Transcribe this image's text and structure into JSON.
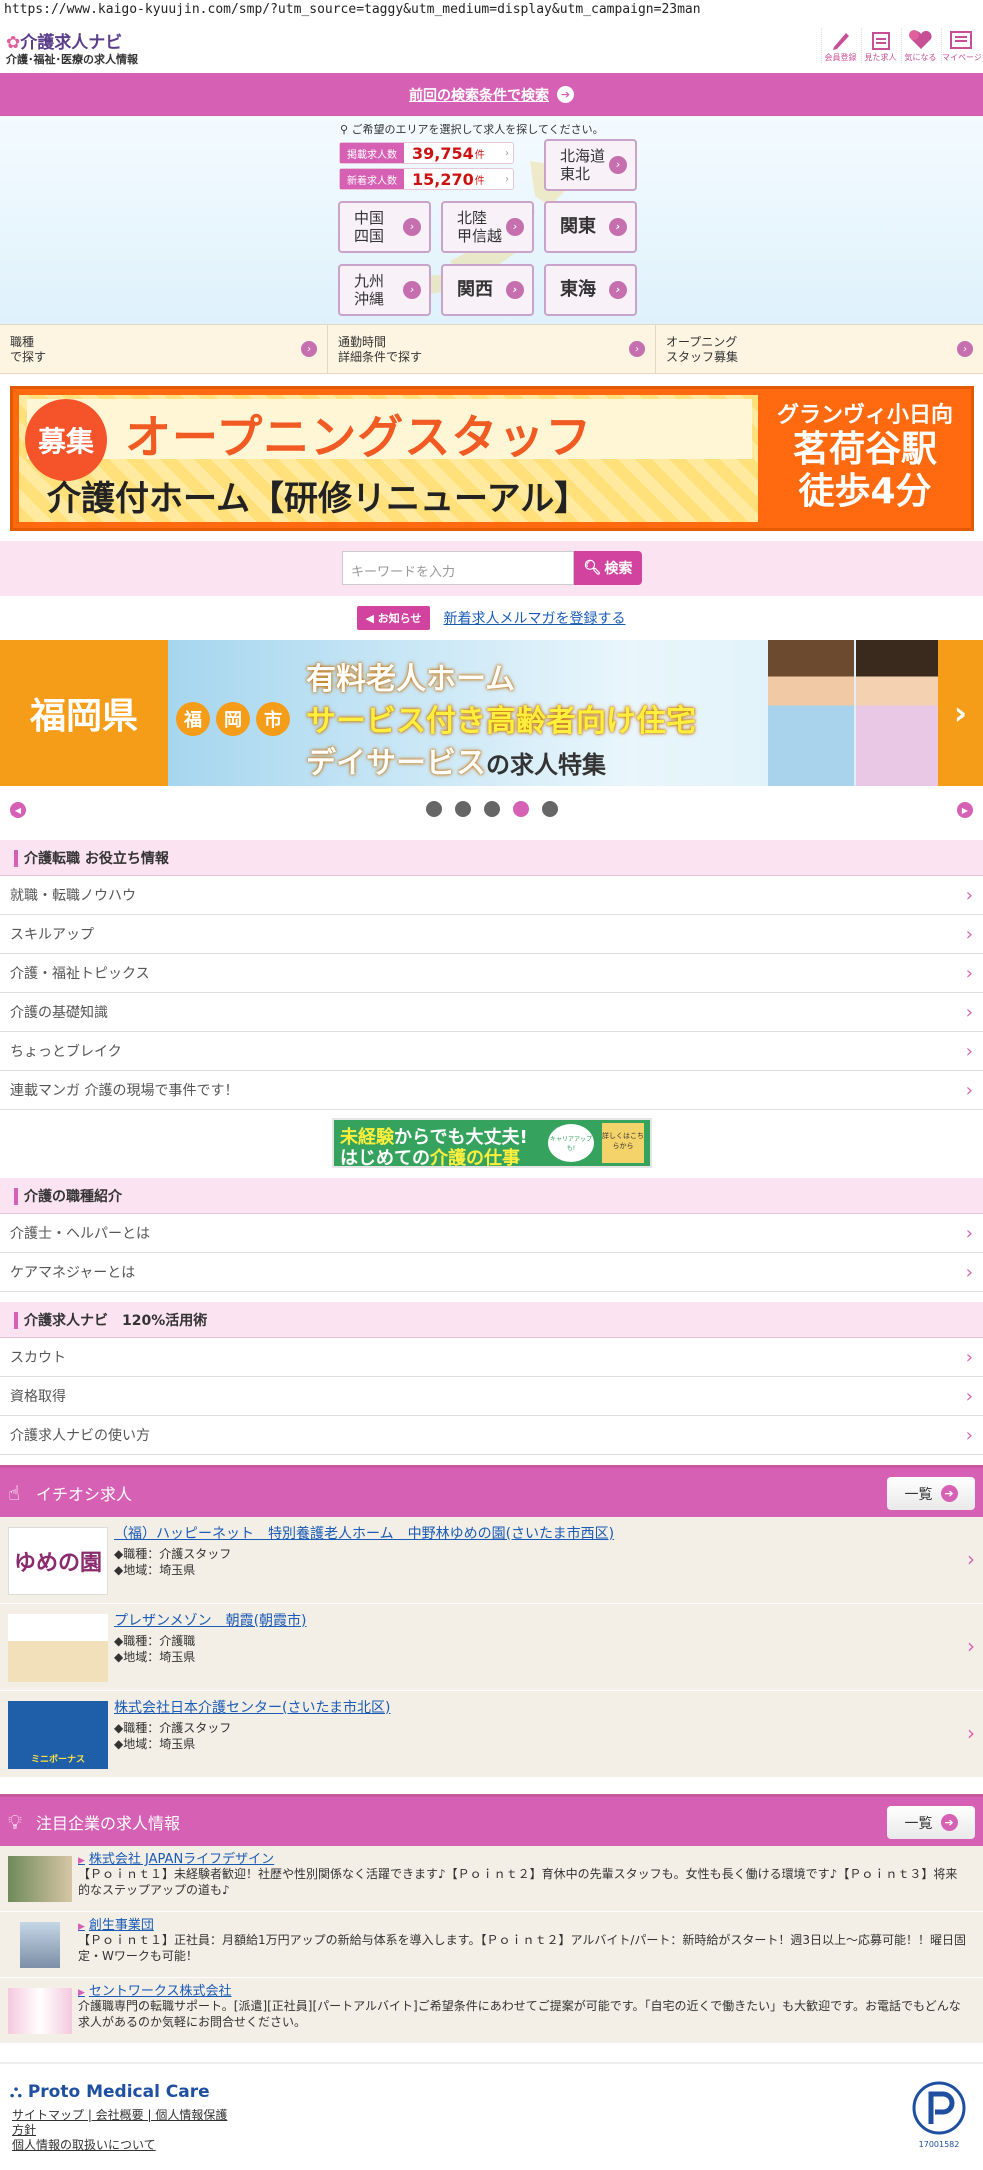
{
  "url": "https://www.kaigo-kyuujin.com/smp/?utm_source=taggy&utm_medium=display&utm_campaign=23man",
  "header": {
    "logo_title": "介護求人ナビ",
    "logo_sub": "介護･福祉･医療の求人情報",
    "icons": [
      {
        "name": "pencil-icon",
        "label": "会員登録"
      },
      {
        "name": "calendar-icon",
        "label": "見た求人"
      },
      {
        "name": "heart-icon",
        "label": "気になる"
      },
      {
        "name": "mypage-icon",
        "label": "マイページ"
      }
    ]
  },
  "prev_search": "前回の検索条件で検索",
  "area": {
    "note": "ご希望のエリアを選択して求人を探してください。",
    "count1_label": "掲載求人数",
    "count1": "39,754",
    "count2_label": "新着求人数",
    "count2": "15,270",
    "unit": "件",
    "regions": [
      "北海道\n東北",
      "中国\n四国",
      "北陸\n甲信越",
      "関東",
      "九州\n沖縄",
      "関西",
      "東海"
    ]
  },
  "search_bar": {
    "c1": "職種\nで探す",
    "c2": "通勤時間\n詳細条件で探す",
    "c3": "オープニング\nスタッフ募集"
  },
  "banner1": {
    "boshu": "募集",
    "headline": "オープニングスタッフ",
    "sub": "介護付ホーム【研修リニューアル】",
    "place": "グランヴィ小日向",
    "station": "茗荷谷駅",
    "walk": "徒歩4分"
  },
  "keyword": {
    "placeholder": "キーワードを入力",
    "button": "検索"
  },
  "notice": {
    "tag": "お知らせ",
    "link": "新着求人メルマガを登録する"
  },
  "carousel": {
    "pref": "福岡県",
    "city": [
      "福",
      "岡",
      "市"
    ],
    "line1": "有料老人ホーム",
    "line2": "サービス付き高齢者向け住宅",
    "line3": "デイサービス",
    "line3b": "の求人特集",
    "dots": 5,
    "active": 4
  },
  "sec1": {
    "title": "介護転職 お役立ち情報",
    "items": [
      "就職・転職ノウハウ",
      "スキルアップ",
      "介護・福祉トピックス",
      "介護の基礎知識",
      "ちょっとブレイク",
      "連載マンガ 介護の現場で事件です！"
    ]
  },
  "banner2": {
    "a1": "未経験",
    "a2": "からでも大丈夫!",
    "b1": "はじめての",
    "b2": "介護の仕事",
    "circle": "キャリアアップも!",
    "box": "詳しくはこちらから"
  },
  "sec2": {
    "title": "介護の職種紹介",
    "items": [
      "介護士・ヘルパーとは",
      "ケアマネジャーとは"
    ]
  },
  "sec3": {
    "title": "介護求人ナビ　120%活用術",
    "items": [
      "スカウト",
      "資格取得",
      "介護求人ナビの使い方"
    ]
  },
  "pickup": {
    "title": "イチオシ求人",
    "more": "一覧",
    "items": [
      {
        "title": "（福）ハッピーネット　特別養護老人ホーム　中野林ゆめの園(さいたま市西区)",
        "job": "◆職種：介護スタッフ",
        "area": "◆地域：埼玉県",
        "img_text": "ゆめの園"
      },
      {
        "title": "プレザンメゾン　朝霞(朝霞市)",
        "job": "◆職種：介護職",
        "area": "◆地域：埼玉県",
        "img_text": ""
      },
      {
        "title": "株式会社日本介護センター(さいたま市北区)",
        "job": "◆職種：介護スタッフ",
        "area": "◆地域：埼玉県",
        "img_text": "ミニボーナス"
      }
    ]
  },
  "company": {
    "title": "注目企業の求人情報",
    "more": "一覧",
    "items": [
      {
        "name": "株式会社 JAPANライフデザイン",
        "desc": "【Ｐｏｉｎｔ１】未経験者歓迎！社歴や性別関係なく活躍できます♪【Ｐｏｉｎｔ２】育休中の先輩スタッフも。女性も長く働ける環境です♪【Ｐｏｉｎｔ３】将来的なステップアップの道も♪"
      },
      {
        "name": "創生事業団",
        "desc": "【Ｐｏｉｎｔ１】正社員：月額給1万円アップの新給与体系を導入します。【Ｐｏｉｎｔ２】アルバイト/パート：新時給がスタート！週3日以上～応募可能！！曜日固定・Wワークも可能！"
      },
      {
        "name": "セントワークス株式会社",
        "desc": "介護職専門の転職サポート。[派遣][正社員][パートアルバイト]ご希望条件にあわせてご提案が可能です。「自宅の近くで働きたい」も大歓迎です。お電話でもどんな求人があるのか気軽にお問合せください。"
      }
    ]
  },
  "footer": {
    "brand": "Proto Medical Care",
    "links1": "サイトマップ | 会社概要 | 個人情報保護",
    "links2": "方針",
    "links3": "個人情報の取扱いについて",
    "privacy_no": "17001582"
  }
}
